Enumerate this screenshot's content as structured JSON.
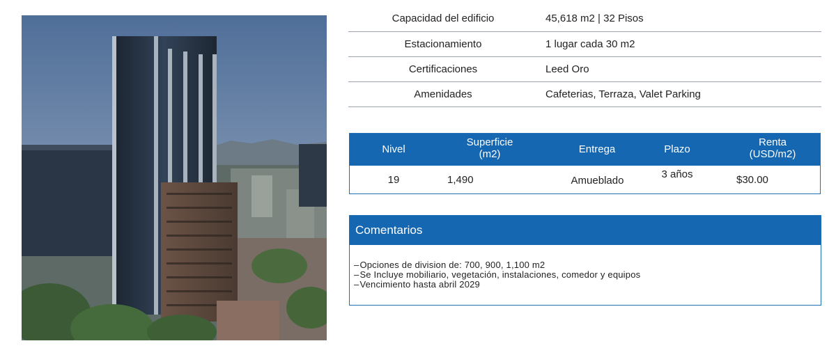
{
  "specs": [
    {
      "label": "Capacidad del edificio",
      "value": "45,618 m2 | 32 Pisos"
    },
    {
      "label": "Estacionamiento",
      "value": "1 lugar cada 30 m2"
    },
    {
      "label": "Certificaciones",
      "value": "Leed Oro"
    },
    {
      "label": "Amenidades",
      "value": "Cafeterias, Terraza, Valet Parking"
    }
  ],
  "level_table": {
    "headers": {
      "nivel": "Nivel",
      "superficie_1": "Superficie",
      "superficie_2": "(m2)",
      "entrega": "Entrega",
      "plazo": "Plazo",
      "renta_1": "Renta",
      "renta_2": "(USD/m2)"
    },
    "row": {
      "nivel": "19",
      "superficie": "1,490",
      "entrega": "Amueblado",
      "plazo": "3 años",
      "renta": "$30.00"
    }
  },
  "comments": {
    "title": "Comentarios",
    "items": [
      "Opciones de division de: 700, 900, 1,100 m2",
      "Se Incluye mobiliario, vegetación, instalaciones, comedor y equipos",
      "Vencimiento hasta abril 2029"
    ]
  },
  "colors": {
    "header_blue": "#1567b2",
    "border_blue": "#1f6fb5",
    "row_divider": "#9aa3ad"
  }
}
